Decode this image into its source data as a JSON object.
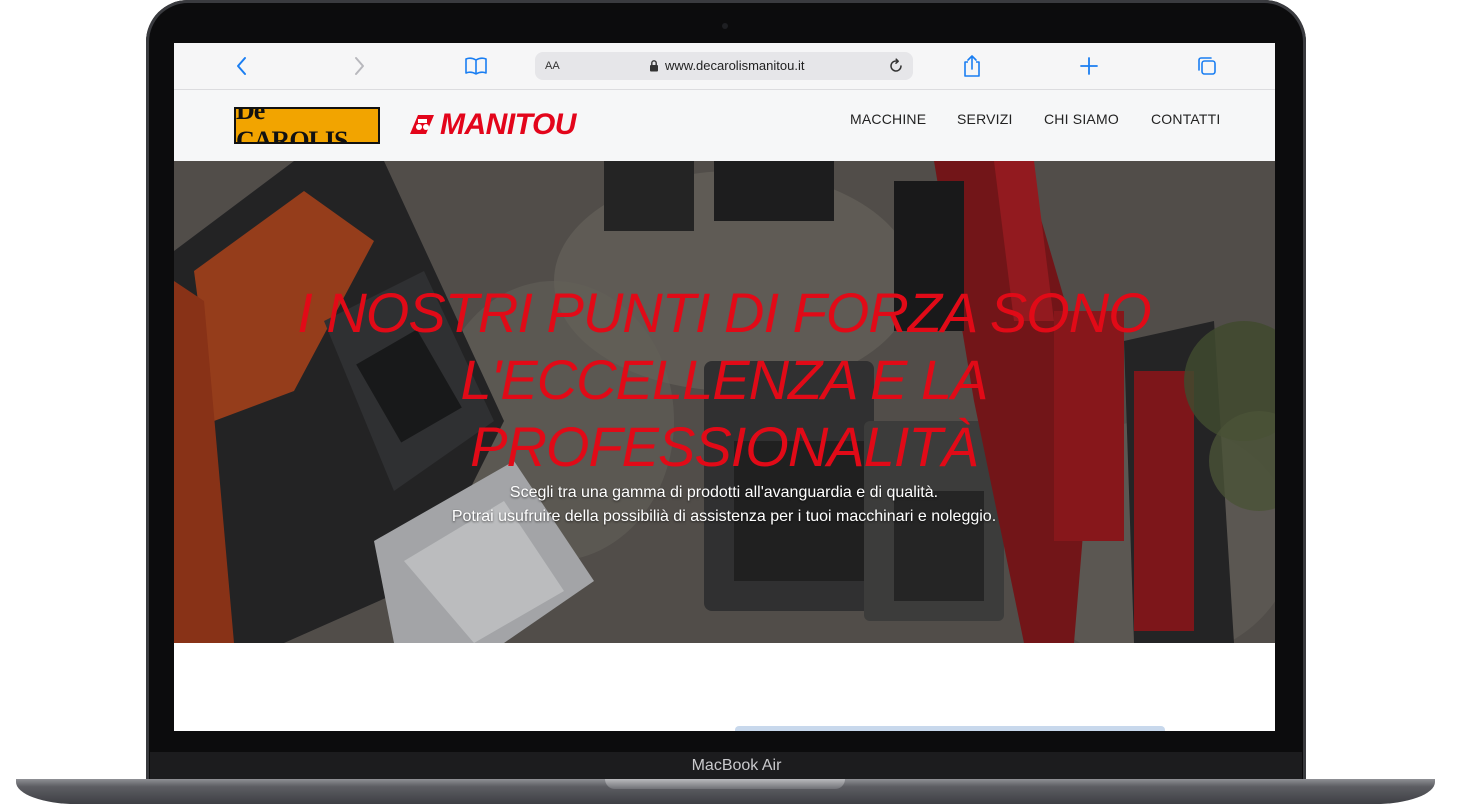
{
  "browser": {
    "text_size_label": "AA",
    "url": "www.decarolismanitou.it",
    "icons": [
      "chevron-left-icon",
      "chevron-right-icon",
      "bookmarks-icon",
      "lock-icon",
      "reload-icon",
      "share-icon",
      "plus-icon",
      "tabs-icon"
    ]
  },
  "site": {
    "logo_decarolis": "De CAROLIS",
    "logo_manitou": "MANITOU",
    "nav": [
      "MACCHINE",
      "SERVIZI",
      "CHI SIAMO",
      "CONTATTI"
    ]
  },
  "hero": {
    "title_line1": "I NOSTRI PUNTI DI FORZA SONO",
    "title_line2": "L'ECCELLENZA E LA",
    "title_line3": "PROFESSIONALITÀ",
    "subtitle_line1": "Scegli tra una gamma di prodotti all'avanguardia e di qualità.",
    "subtitle_line2": "Potrai usufruire della possibilià di assistenza per i tuoi macchinari e noleggio."
  },
  "device": {
    "model": "MacBook Air"
  },
  "colors": {
    "accent_red": "#e10a17",
    "brand_orange": "#f2a400",
    "link_blue": "#1a7ef2"
  }
}
